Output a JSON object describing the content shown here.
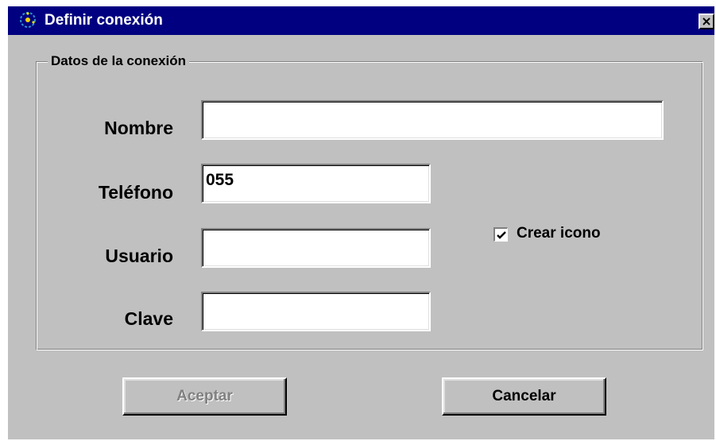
{
  "window": {
    "title": "Definir conexión",
    "title_icon": "globe-icon",
    "close_icon": "close-icon"
  },
  "group": {
    "legend": "Datos de la conexión"
  },
  "fields": {
    "nombre": {
      "label": "Nombre",
      "value": ""
    },
    "telefono": {
      "label": "Teléfono",
      "value": "055"
    },
    "usuario": {
      "label": "Usuario",
      "value": ""
    },
    "clave": {
      "label": "Clave",
      "value": ""
    }
  },
  "checkbox": {
    "label": "Crear icono",
    "checked": true
  },
  "buttons": {
    "accept": {
      "label": "Aceptar",
      "enabled": false
    },
    "cancel": {
      "label": "Cancelar",
      "enabled": true
    }
  },
  "colors": {
    "titlebar": "#000080",
    "face": "#c0c0c0",
    "disabled_text": "#808080"
  }
}
